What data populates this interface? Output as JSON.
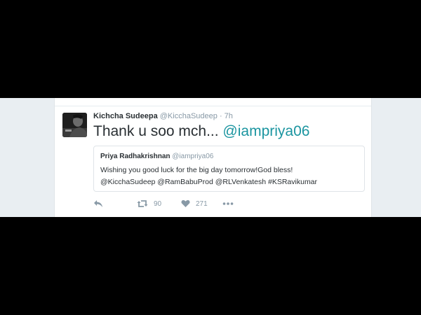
{
  "tweet": {
    "author_name": "Kichcha Sudeepa",
    "author_handle": "@KicchaSudeep",
    "separator": "·",
    "time": "7h",
    "text_prefix": "Thank u soo mch... ",
    "text_mention": "@iampriya06"
  },
  "quoted_tweet": {
    "author_name": "Priya Radhakrishnan",
    "author_handle": "@iampriya06",
    "line1": "Wishing you good luck for the big day tomorrow!God bless!",
    "line2": "@KicchaSudeep @RamBabuProd @RLVenkatesh #KSRavikumar"
  },
  "actions": {
    "reply_icon": "reply-icon",
    "retweet_icon": "retweet-icon",
    "retweet_count": "90",
    "like_icon": "heart-icon",
    "like_count": "271",
    "more_icon": "more-icon"
  },
  "colors": {
    "background": "#000000",
    "card": "#ffffff",
    "band": "#e9eef2",
    "mention": "#1b95a0",
    "muted": "#8899a6",
    "text": "#292f33"
  }
}
